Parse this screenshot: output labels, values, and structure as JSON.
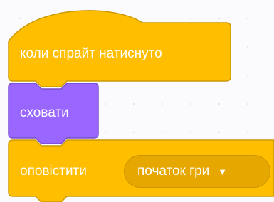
{
  "blocks": {
    "hat": {
      "label": "коли спрайт натиснуто",
      "color": "#ffbf00",
      "border": "#cc9900",
      "category": "events"
    },
    "hide": {
      "label": "сховати",
      "color": "#9966ff",
      "border": "#774dcb",
      "category": "looks"
    },
    "broadcast": {
      "label": "оповістити",
      "color": "#ffbf00",
      "border": "#cc9900",
      "category": "events",
      "message": {
        "value": "початок гри",
        "icon": "dropdown-arrow-icon"
      }
    }
  }
}
